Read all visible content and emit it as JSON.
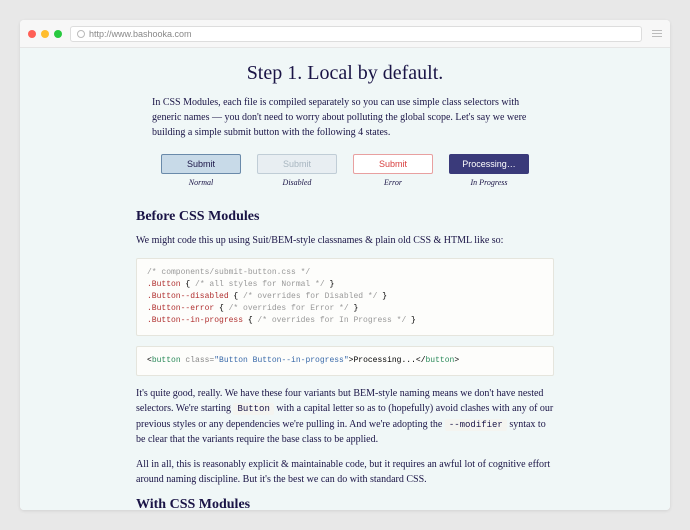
{
  "browser": {
    "url": "http://www.bashooka.com"
  },
  "page": {
    "heading": "Step 1. Local by default.",
    "intro": "In CSS Modules, each file is compiled separately so you can use simple class selectors with generic names — you don't need to worry about polluting the global scope. Let's say we were building a simple submit button with the following 4 states.",
    "buttons": [
      {
        "label": "Submit",
        "state": "Normal",
        "class": "normal"
      },
      {
        "label": "Submit",
        "state": "Disabled",
        "class": "disabled"
      },
      {
        "label": "Submit",
        "state": "Error",
        "class": "error"
      },
      {
        "label": "Processing…",
        "state": "In Progress",
        "class": "progress"
      }
    ],
    "before_heading": "Before CSS Modules",
    "before_intro": "We might code this up using Suit/BEM-style classnames & plain old CSS & HTML like so:",
    "css_code": {
      "l1": "/* components/submit-button.css */",
      "l2a": ".Button",
      "l2b": " { ",
      "l2c": "/* all styles for Normal */",
      "l2d": " }",
      "l3a": ".Button--disabled",
      "l3b": " { ",
      "l3c": "/* overrides for Disabled */",
      "l3d": " }",
      "l4a": ".Button--error",
      "l4b": " { ",
      "l4c": "/* overrides for Error */",
      "l4d": " }",
      "l5a": ".Button--in-progress",
      "l5b": " { ",
      "l5c": "/* overrides for In Progress */",
      "l5d": " }"
    },
    "html_code": {
      "a": "<",
      "b": "button",
      "c": " class=",
      "d": "\"Button Button--in-progress\"",
      "e": ">",
      "f": "Processing...",
      "g": "</",
      "h": "button",
      "i": ">"
    },
    "para1_a": "It's quite good, really. We have these four variants but BEM-style naming means we don't have nested selectors. We're starting ",
    "para1_code1": "Button",
    "para1_b": " with a capital letter so as to (hopefully) avoid clashes with any of our previous styles or any dependencies we're pulling in. And we're adopting the ",
    "para1_code2": "--modifier",
    "para1_c": " syntax to be clear that the variants require the base class to be applied.",
    "para2": "All in all, this is reasonably explicit & maintainable code, but it requires an awful lot of cognitive effort around naming discipline. But it's the best we can do with standard CSS.",
    "with_heading": "With CSS Modules"
  }
}
